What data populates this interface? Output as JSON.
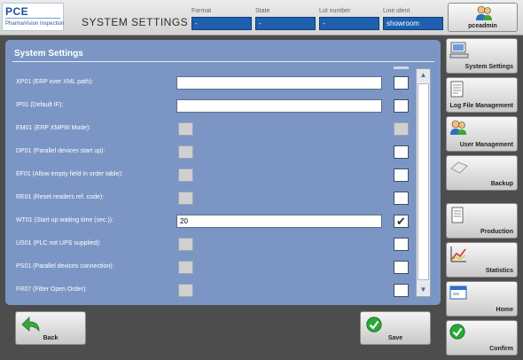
{
  "header": {
    "logo_main": "PCE",
    "logo_sub": "PharmaVision Inspection",
    "title": "SYSTEM SETTINGS",
    "fields": [
      {
        "label": "Format",
        "value": "-"
      },
      {
        "label": "State",
        "value": "-"
      },
      {
        "label": "Lot number",
        "value": "-"
      },
      {
        "label": "Line ident",
        "value": "showroom"
      }
    ],
    "user": "pceadmin"
  },
  "panel": {
    "title": "System Settings",
    "rows": [
      {
        "label": "XP01 (ERP over XML path):",
        "kind": "text",
        "value": "",
        "checked": false,
        "check_disabled": false
      },
      {
        "label": "IP01 (Default IF):",
        "kind": "text",
        "value": "",
        "checked": false,
        "check_disabled": false
      },
      {
        "label": "EM01 (ERP XMPW Mode):",
        "kind": "bool",
        "value": "",
        "checked": false,
        "check_disabled": true
      },
      {
        "label": "DP01 (Parallel devices start up):",
        "kind": "bool",
        "value": "",
        "checked": false,
        "check_disabled": false
      },
      {
        "label": "EF01 (Allow empty field in order table):",
        "kind": "bool",
        "value": "",
        "checked": false,
        "check_disabled": false
      },
      {
        "label": "RE01 (Reset readers ref. code):",
        "kind": "bool",
        "value": "",
        "checked": false,
        "check_disabled": false
      },
      {
        "label": "WT01 (Start up waiting time (sec.)):",
        "kind": "text",
        "value": "20",
        "checked": true,
        "check_disabled": false
      },
      {
        "label": "US01 (PLC not UPS supplied):",
        "kind": "bool",
        "value": "",
        "checked": false,
        "check_disabled": false
      },
      {
        "label": "PS01 (Parallel devices connection):",
        "kind": "bool",
        "value": "",
        "checked": false,
        "check_disabled": false
      },
      {
        "label": "FR07 (Filter Open Order):",
        "kind": "bool",
        "value": "",
        "checked": false,
        "check_disabled": false
      }
    ]
  },
  "buttons": {
    "back": "Back",
    "save": "Save"
  },
  "sidebar": {
    "items": [
      {
        "label": "System Settings",
        "icon": "computer-icon"
      },
      {
        "label": "Log File Management",
        "icon": "document-icon"
      },
      {
        "label": "User Management",
        "icon": "users-icon"
      },
      {
        "label": "Backup",
        "icon": "eraser-icon"
      },
      {
        "label": "Production",
        "icon": "document-icon"
      },
      {
        "label": "Statistics",
        "icon": "chart-icon"
      },
      {
        "label": "Home",
        "icon": "window-icon"
      },
      {
        "label": "Confirm",
        "icon": "checkmark-icon"
      }
    ]
  },
  "colors": {
    "panel": "#7b96c4",
    "header_field": "#1f5fb0",
    "confirm_green": "#2aa83a"
  }
}
